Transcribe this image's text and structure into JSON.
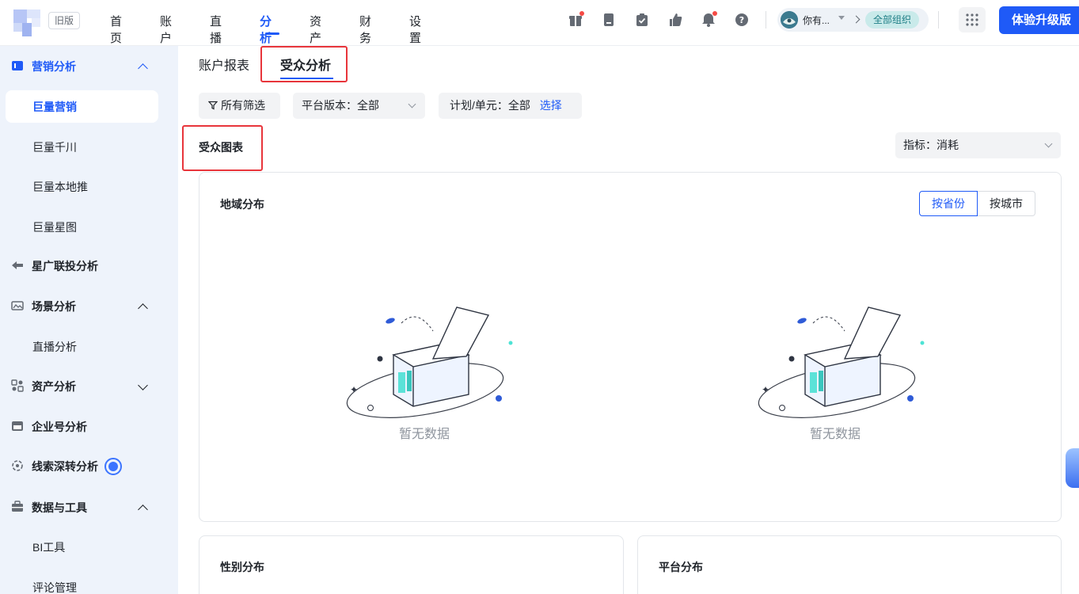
{
  "header": {
    "old_version": "旧版",
    "nav": [
      "首页",
      "账户",
      "直播",
      "分析",
      "资产",
      "财务",
      "设置"
    ],
    "active_nav_index": 3,
    "user_name": "你有...",
    "org_label": "全部组织",
    "upgrade_label": "体验升级版",
    "brand_color": "#1f5af7"
  },
  "sidebar": {
    "groups": [
      {
        "label": "营销分析",
        "icon": "marketing-icon",
        "expanded": true,
        "children": [
          "巨量营销",
          "巨量千川",
          "巨量本地推",
          "巨量星图"
        ]
      },
      {
        "label": "星广联投分析",
        "icon": "star-link-icon"
      },
      {
        "label": "场景分析",
        "icon": "scene-icon",
        "expanded": true,
        "children": [
          "直播分析"
        ]
      },
      {
        "label": "资产分析",
        "icon": "asset-icon",
        "expanded": false
      },
      {
        "label": "企业号分析",
        "icon": "enterprise-icon"
      },
      {
        "label": "线索深转分析",
        "icon": "lead-icon"
      },
      {
        "label": "数据与工具",
        "icon": "data-tools-icon",
        "expanded": true,
        "children": [
          "BI工具",
          "评论管理"
        ]
      }
    ],
    "selected": "巨量营销"
  },
  "main": {
    "tabs": [
      "账户报表",
      "受众分析"
    ],
    "active_tab": "受众分析",
    "filters": {
      "all_filters": "所有筛选",
      "platform_label": "平台版本：",
      "platform_value": "全部",
      "plan_label": "计划/单元：",
      "plan_value": "全部",
      "plan_action": "选择"
    },
    "section_title": "受众图表",
    "metric_label": "指标：",
    "metric_value": "消耗",
    "region_card": {
      "title": "地域分布",
      "toggle": [
        "按省份",
        "按城市"
      ],
      "active_toggle": "按省份",
      "empty_left": "暂无数据",
      "empty_right": "暂无数据"
    },
    "gender_card_title": "性别分布",
    "platform_card_title": "平台分布"
  }
}
